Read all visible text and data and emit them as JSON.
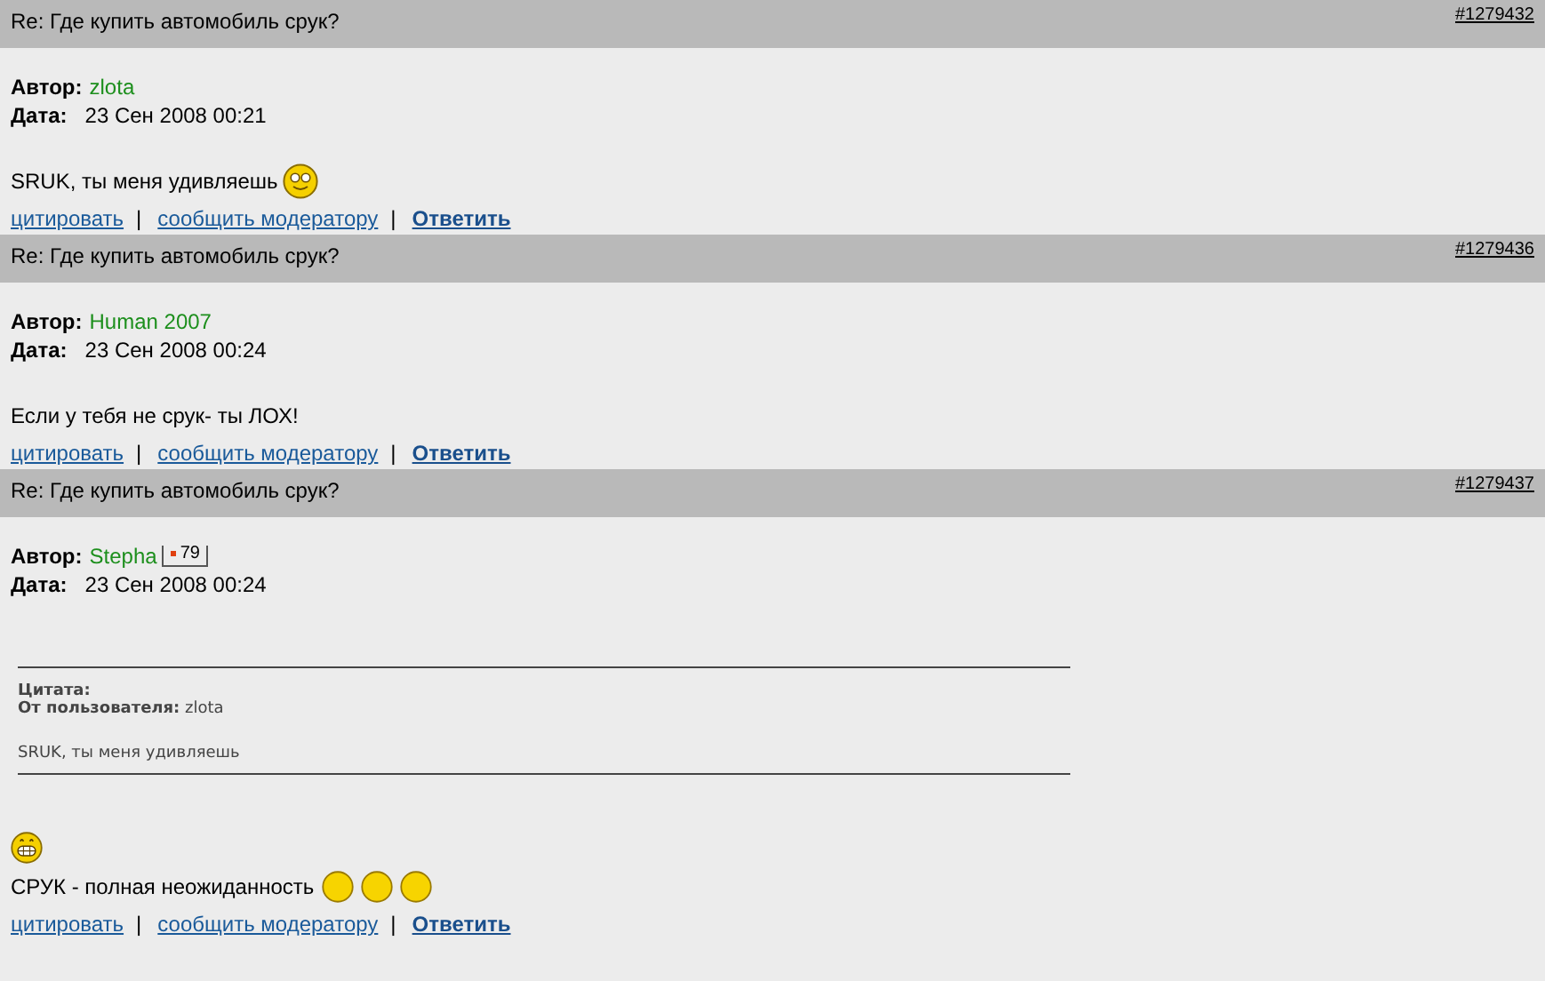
{
  "posts": [
    {
      "title": "Re: Где купить автомобиль срук?",
      "number": "#1279432",
      "author_label": "Автор:",
      "author": "zlota",
      "date_label": "Дата:",
      "date": "23 Сен 2008 00:21",
      "body": [
        [
          {
            "kind": "text",
            "text": "SRUK, ты меня удивляешь"
          },
          {
            "kind": "smiley"
          }
        ]
      ],
      "actions": [
        {
          "kind": "link",
          "label": "цитировать",
          "strong": false
        },
        {
          "kind": "separator",
          "label": "|"
        },
        {
          "kind": "link",
          "label": "сообщить модератору",
          "strong": false
        },
        {
          "kind": "separator",
          "label": "|"
        },
        {
          "kind": "link",
          "label": "Ответить",
          "strong": true
        }
      ]
    },
    {
      "title": "Re: Где купить автомобиль срук?",
      "number": "#1279436",
      "author_label": "Автор:",
      "author": "Human 2007",
      "date_label": "Дата:",
      "date": "23 Сен 2008 00:24",
      "body": [
        [
          {
            "kind": "text",
            "text": "Если у тебя не срук- ты ЛОХ!"
          }
        ]
      ],
      "actions": [
        {
          "kind": "link",
          "label": "цитировать",
          "strong": false
        },
        {
          "kind": "separator",
          "label": "|"
        },
        {
          "kind": "link",
          "label": "сообщить модератору",
          "strong": false
        },
        {
          "kind": "separator",
          "label": "|"
        },
        {
          "kind": "link",
          "label": "Ответить",
          "strong": true
        }
      ]
    },
    {
      "title": "Re: Где купить автомобиль срук?",
      "number": "#1279437",
      "author_label": "Автор:",
      "author": "Stepha",
      "author_score": "79",
      "date_label": "Дата:",
      "date": "23 Сен 2008 00:24",
      "quote": {
        "label": "Цитата:",
        "from_label": "От пользователя:",
        "from": "zlota",
        "text": "SRUK, ты меня удивляешь"
      },
      "body": [
        [
          {
            "kind": "grin"
          }
        ],
        [
          {
            "kind": "text",
            "text": "СРУК - полная неожиданность"
          },
          {
            "kind": "ball"
          },
          {
            "kind": "ball"
          },
          {
            "kind": "ball"
          }
        ]
      ],
      "actions": [
        {
          "kind": "link",
          "label": "цитировать",
          "strong": false
        },
        {
          "kind": "separator",
          "label": "|"
        },
        {
          "kind": "link",
          "label": "сообщить модератору",
          "strong": false
        },
        {
          "kind": "separator",
          "label": "|"
        },
        {
          "kind": "link",
          "label": "Ответить",
          "strong": true
        }
      ]
    }
  ]
}
